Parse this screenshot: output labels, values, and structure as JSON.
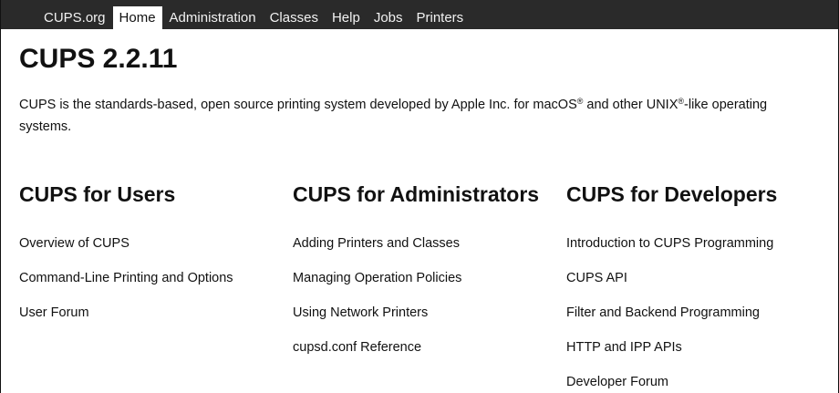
{
  "nav": {
    "items": [
      {
        "label": "CUPS.org",
        "active": false
      },
      {
        "label": "Home",
        "active": true
      },
      {
        "label": "Administration",
        "active": false
      },
      {
        "label": "Classes",
        "active": false
      },
      {
        "label": "Help",
        "active": false
      },
      {
        "label": "Jobs",
        "active": false
      },
      {
        "label": "Printers",
        "active": false
      }
    ]
  },
  "main": {
    "title": "CUPS 2.2.11",
    "intro_part1": "CUPS is the standards-based, open source printing system developed by Apple Inc. for macOS",
    "intro_reg1": "®",
    "intro_part2": " and other UNIX",
    "intro_reg2": "®",
    "intro_part3": "-like operating systems."
  },
  "sections": [
    {
      "heading": "CUPS for Users",
      "links": [
        "Overview of CUPS",
        "Command-Line Printing and Options",
        "User Forum"
      ]
    },
    {
      "heading": "CUPS for Administrators",
      "links": [
        "Adding Printers and Classes",
        "Managing Operation Policies",
        "Using Network Printers",
        "cupsd.conf Reference"
      ]
    },
    {
      "heading": "CUPS for Developers",
      "links": [
        "Introduction to CUPS Programming",
        "CUPS API",
        "Filter and Backend Programming",
        "HTTP and IPP APIs",
        "Developer Forum"
      ]
    }
  ]
}
